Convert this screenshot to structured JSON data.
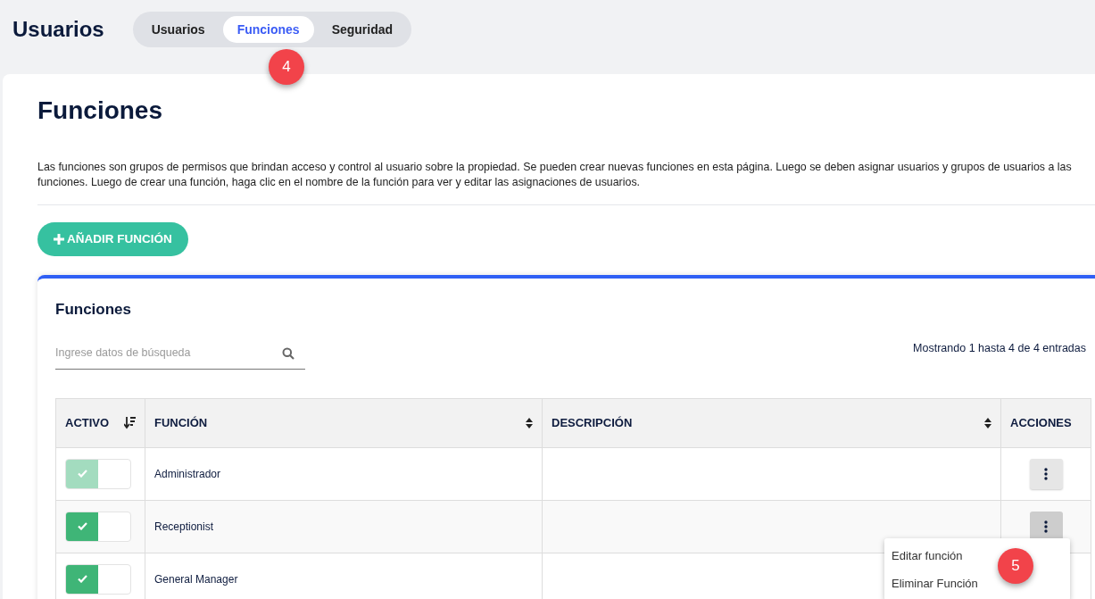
{
  "page_title": "Usuarios",
  "tabs": [
    {
      "label": "Usuarios",
      "selected": false
    },
    {
      "label": "Funciones",
      "selected": true
    },
    {
      "label": "Seguridad",
      "selected": false
    }
  ],
  "section": {
    "title": "Funciones",
    "description": "Las funciones son grupos de permisos que brindan acceso y control al usuario sobre la propiedad. Se pueden crear nuevas funciones en esta página. Luego se deben asignar usuarios y grupos de usuarios a las funciones. Luego de crear una función, haga clic en el nombre de la función para ver y editar las asignaciones de usuarios.",
    "add_button": "AÑADIR FUNCIÓN"
  },
  "panel": {
    "title": "Funciones",
    "search": {
      "placeholder": "Ingrese datos de búsqueda"
    },
    "entries_info": "Mostrando 1 hasta 4 de 4 entradas",
    "table": {
      "columns": [
        {
          "label": "ACTIVO",
          "sortable": true,
          "sorted": true
        },
        {
          "label": "FUNCIÓN",
          "sortable": true,
          "sorted": false
        },
        {
          "label": "DESCRIPCIÓN",
          "sortable": true,
          "sorted": false
        },
        {
          "label": "ACCIONES",
          "sortable": false,
          "sorted": false
        }
      ],
      "rows": [
        {
          "active": true,
          "disabled": true,
          "name": "Administrador",
          "menu_open": false
        },
        {
          "active": true,
          "disabled": false,
          "name": "Receptionist",
          "menu_open": true
        },
        {
          "active": true,
          "disabled": false,
          "name": "General Manager",
          "menu_open": false
        }
      ]
    }
  },
  "context_menu": {
    "items": [
      "Editar función",
      "Eliminar Función"
    ]
  },
  "step_markers": [
    "4",
    "5"
  ]
}
